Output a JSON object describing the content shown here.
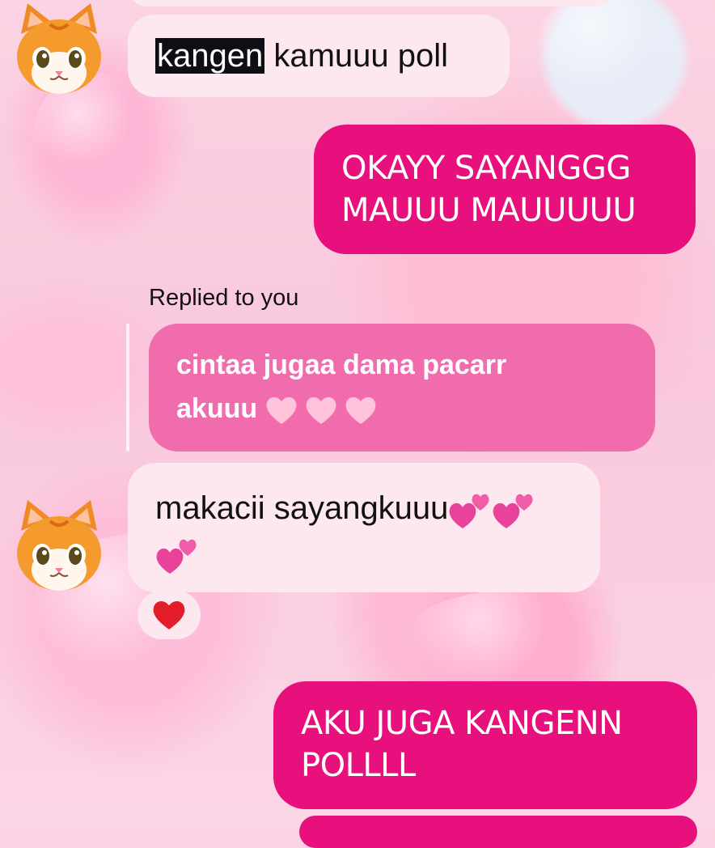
{
  "messages": [
    {
      "id": "m1",
      "direction": "incoming",
      "text_highlight": "kangen",
      "text_rest": " kamuuu poll"
    },
    {
      "id": "m2",
      "direction": "outgoing",
      "lines": [
        "OKAYY SAYANGGG",
        "MAUUU MAUUUUU"
      ]
    },
    {
      "id": "m3",
      "direction": "outgoing-reply",
      "reply_label": "Replied to you",
      "lines": [
        "cintaa jugaa dama pacarr",
        "akuuu"
      ],
      "trailing_emoji": "pink-heart x3"
    },
    {
      "id": "m4",
      "direction": "incoming",
      "lines": [
        "makacii sayangkuuu"
      ],
      "trailing_emoji": "two-hearts x3",
      "reaction": "red-heart"
    },
    {
      "id": "m5",
      "direction": "outgoing",
      "lines": [
        "AKU JUGA KANGENN",
        "POLLLL"
      ]
    }
  ],
  "colors": {
    "outgoing_bubble": "#e8107c",
    "reply_bubble": "#f06cad",
    "incoming_bubble": "#fde8f0",
    "background": "#f9c8dc"
  },
  "icons": [
    "cat-avatar-icon",
    "pink-heart-icon",
    "two-hearts-icon",
    "red-heart-icon"
  ]
}
